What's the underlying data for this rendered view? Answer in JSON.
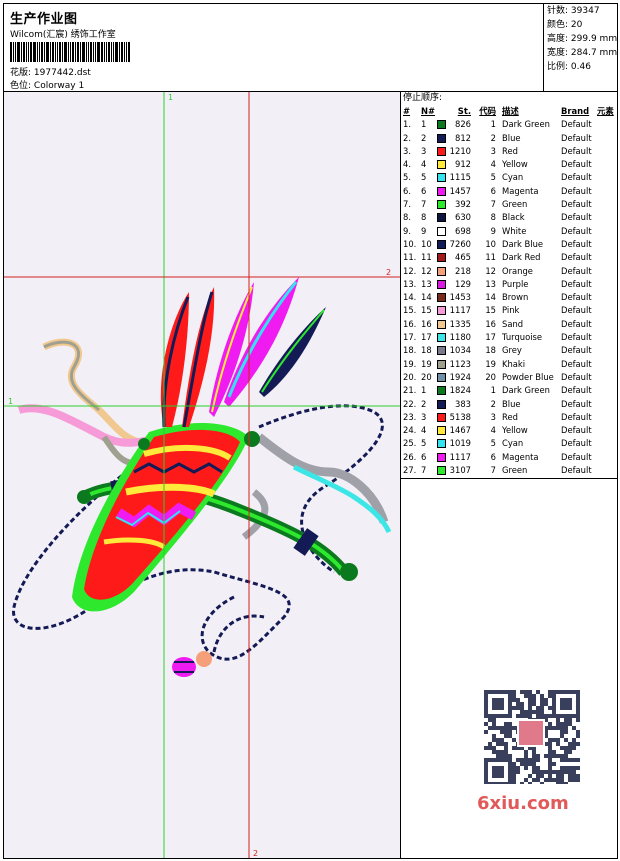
{
  "header": {
    "title": "生产作业图",
    "company": "Wilcom(汇宸) 绣饰工作室",
    "pattern_label": "花版:",
    "pattern_value": "1977442.dst",
    "colorway_label": "色位:",
    "colorway_value": "Colorway 1"
  },
  "stats": {
    "stitches_label": "针数:",
    "stitches_value": "39347",
    "colors_label": "颜色:",
    "colors_value": "20",
    "height_label": "高度:",
    "height_value": "299.9 mm",
    "width_label": "宽度:",
    "width_value": "284.7 mm",
    "ratio_label": "比例:",
    "ratio_value": "0.46"
  },
  "guides": {
    "v1_label": "1",
    "h1_label": "1",
    "h2_label": "2",
    "v2_label": "2"
  },
  "legend": {
    "title": "停止顺序:",
    "headers": {
      "index": "#",
      "n": "N#",
      "stitches": "St.",
      "code": "代码",
      "desc": "描述",
      "brand": "Brand",
      "element": "元素"
    },
    "rows": [
      {
        "idx": "1.",
        "n": "1",
        "color": "#0b7a1e",
        "st": "826",
        "code": "1",
        "desc": "Dark Green",
        "brand": "Default"
      },
      {
        "idx": "2.",
        "n": "2",
        "color": "#141a55",
        "st": "812",
        "code": "2",
        "desc": "Blue",
        "brand": "Default"
      },
      {
        "idx": "3.",
        "n": "3",
        "color": "#ff1a1a",
        "st": "1210",
        "code": "3",
        "desc": "Red",
        "brand": "Default"
      },
      {
        "idx": "4.",
        "n": "4",
        "color": "#ffe93b",
        "st": "912",
        "code": "4",
        "desc": "Yellow",
        "brand": "Default"
      },
      {
        "idx": "5.",
        "n": "5",
        "color": "#33e3f0",
        "st": "1115",
        "code": "5",
        "desc": "Cyan",
        "brand": "Default"
      },
      {
        "idx": "6.",
        "n": "6",
        "color": "#f01bf0",
        "st": "1457",
        "code": "6",
        "desc": "Magenta",
        "brand": "Default"
      },
      {
        "idx": "7.",
        "n": "7",
        "color": "#2de82d",
        "st": "392",
        "code": "7",
        "desc": "Green",
        "brand": "Default"
      },
      {
        "idx": "8.",
        "n": "8",
        "color": "#0d1440",
        "st": "630",
        "code": "8",
        "desc": "Black",
        "brand": "Default"
      },
      {
        "idx": "9.",
        "n": "9",
        "color": "#ffffff",
        "st": "698",
        "code": "9",
        "desc": "White",
        "brand": "Default"
      },
      {
        "idx": "10.",
        "n": "10",
        "color": "#101c5a",
        "st": "7260",
        "code": "10",
        "desc": "Dark Blue",
        "brand": "Default"
      },
      {
        "idx": "11.",
        "n": "11",
        "color": "#a31a1a",
        "st": "465",
        "code": "11",
        "desc": "Dark Red",
        "brand": "Default"
      },
      {
        "idx": "12.",
        "n": "12",
        "color": "#f5a07a",
        "st": "218",
        "code": "12",
        "desc": "Orange",
        "brand": "Default"
      },
      {
        "idx": "13.",
        "n": "13",
        "color": "#d81be0",
        "st": "129",
        "code": "13",
        "desc": "Purple",
        "brand": "Default"
      },
      {
        "idx": "14.",
        "n": "14",
        "color": "#7a2a1a",
        "st": "1453",
        "code": "14",
        "desc": "Brown",
        "brand": "Default"
      },
      {
        "idx": "15.",
        "n": "15",
        "color": "#f79ad8",
        "st": "1117",
        "code": "15",
        "desc": "Pink",
        "brand": "Default"
      },
      {
        "idx": "16.",
        "n": "16",
        "color": "#f0c890",
        "st": "1335",
        "code": "16",
        "desc": "Sand",
        "brand": "Default"
      },
      {
        "idx": "17.",
        "n": "17",
        "color": "#3de6e6",
        "st": "1180",
        "code": "17",
        "desc": "Turquoise",
        "brand": "Default"
      },
      {
        "idx": "18.",
        "n": "18",
        "color": "#7a7a8a",
        "st": "1034",
        "code": "18",
        "desc": "Grey",
        "brand": "Default"
      },
      {
        "idx": "19.",
        "n": "19",
        "color": "#a0a090",
        "st": "1123",
        "code": "19",
        "desc": "Khaki",
        "brand": "Default"
      },
      {
        "idx": "20.",
        "n": "20",
        "color": "#7090a8",
        "st": "1924",
        "code": "20",
        "desc": "Powder Blue",
        "brand": "Default"
      },
      {
        "idx": "21.",
        "n": "1",
        "color": "#0b7a1e",
        "st": "1824",
        "code": "1",
        "desc": "Dark Green",
        "brand": "Default"
      },
      {
        "idx": "22.",
        "n": "2",
        "color": "#141a55",
        "st": "383",
        "code": "2",
        "desc": "Blue",
        "brand": "Default"
      },
      {
        "idx": "23.",
        "n": "3",
        "color": "#ff1a1a",
        "st": "5138",
        "code": "3",
        "desc": "Red",
        "brand": "Default"
      },
      {
        "idx": "24.",
        "n": "4",
        "color": "#ffe93b",
        "st": "1467",
        "code": "4",
        "desc": "Yellow",
        "brand": "Default"
      },
      {
        "idx": "25.",
        "n": "5",
        "color": "#33e3f0",
        "st": "1019",
        "code": "5",
        "desc": "Cyan",
        "brand": "Default"
      },
      {
        "idx": "26.",
        "n": "6",
        "color": "#f01bf0",
        "st": "1117",
        "code": "6",
        "desc": "Magenta",
        "brand": "Default"
      },
      {
        "idx": "27.",
        "n": "7",
        "color": "#2de82d",
        "st": "3107",
        "code": "7",
        "desc": "Green",
        "brand": "Default"
      }
    ]
  },
  "qr": {
    "icon": "qr-code-icon",
    "stamp_icon": "seal-stamp-icon"
  },
  "watermark": {
    "site": "6xiu.com"
  },
  "colors": {
    "guide_green": "#2ccf2c",
    "guide_red": "#d22020",
    "design_bg": "#f2f0f6",
    "watermark": "#e05a5a"
  }
}
